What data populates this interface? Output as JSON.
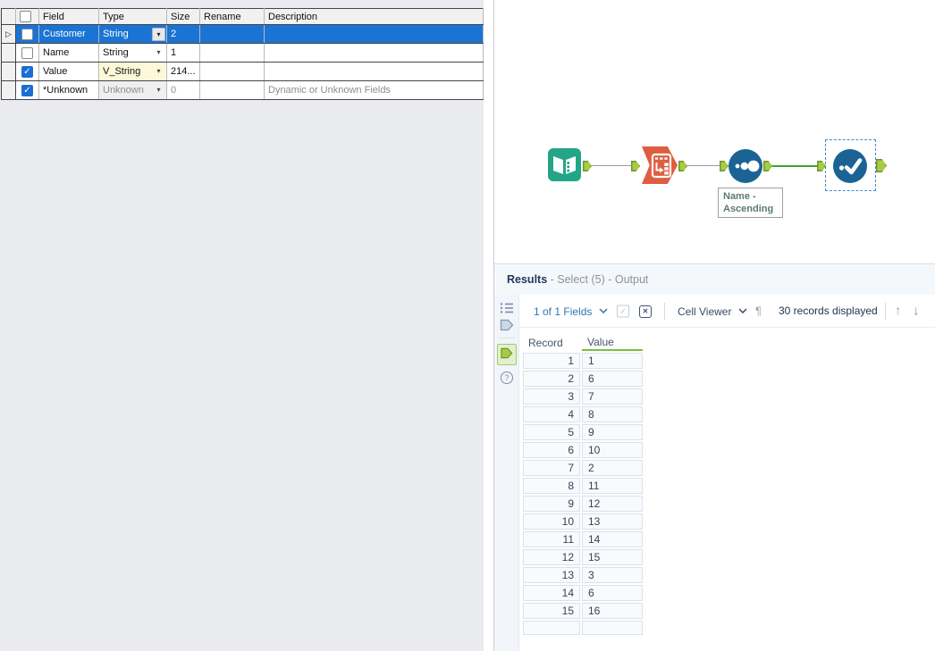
{
  "config": {
    "headers": {
      "field": "Field",
      "type": "Type",
      "size": "Size",
      "rename": "Rename",
      "description": "Description"
    },
    "rows": [
      {
        "field": "Customer",
        "type": "String",
        "size": "2",
        "rename": "",
        "description": "",
        "checked": false,
        "selected": true
      },
      {
        "field": "Name",
        "type": "String",
        "size": "1",
        "rename": "",
        "description": "",
        "checked": false,
        "selected": false
      },
      {
        "field": "Value",
        "type": "V_String",
        "size": "214...",
        "rename": "",
        "description": "",
        "checked": true,
        "selected": false
      },
      {
        "field": "*Unknown",
        "type": "Unknown",
        "size": "0",
        "rename": "",
        "description": "Dynamic or Unknown Fields",
        "checked": true,
        "selected": false
      }
    ]
  },
  "canvas": {
    "annotation": {
      "line1": "Name -",
      "line2": "Ascending"
    },
    "tools": [
      "input-data-tool",
      "transpose-tool",
      "sort-tool",
      "select-tool"
    ]
  },
  "results": {
    "title": "Results",
    "title_suffix": " - Select (5) - Output",
    "toolbar": {
      "fields": "1 of 1 Fields",
      "cell_viewer": "Cell Viewer",
      "records": "30 records displayed"
    },
    "grid": {
      "col_record": "Record",
      "col_value": "Value",
      "rows": [
        [
          "1",
          "1"
        ],
        [
          "2",
          "6"
        ],
        [
          "3",
          "7"
        ],
        [
          "4",
          "8"
        ],
        [
          "5",
          "9"
        ],
        [
          "6",
          "10"
        ],
        [
          "7",
          "2"
        ],
        [
          "8",
          "11"
        ],
        [
          "9",
          "12"
        ],
        [
          "10",
          "13"
        ],
        [
          "11",
          "14"
        ],
        [
          "12",
          "15"
        ],
        [
          "13",
          "3"
        ],
        [
          "14",
          "6"
        ],
        [
          "15",
          "16"
        ]
      ]
    }
  },
  "glyphs": {
    "dropdown": "▾",
    "row_indicator": "▷",
    "check": "✓",
    "close": "✕",
    "pilcrow": "¶",
    "up_arrow": "↑",
    "down_arrow": "↓",
    "help": "?"
  },
  "colors": {
    "selection_blue": "#1b74d4",
    "tool_blue": "#1b6394",
    "input_teal": "#23a587",
    "transform_orange": "#dd5e41",
    "anchor_green": "#a6cc44",
    "connection_green": "#3aa233",
    "value_underline_green": "#76c043",
    "type_highlight_yellow": "#fdf9d8"
  }
}
